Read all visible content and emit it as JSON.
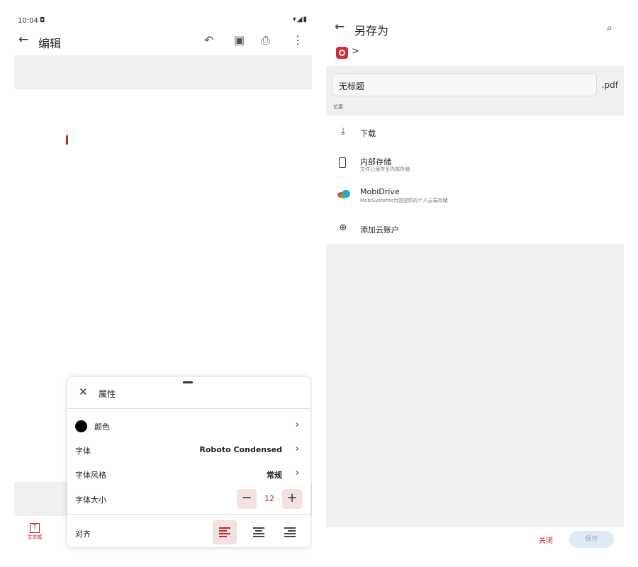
{
  "left": {
    "status": {
      "time": "10:04",
      "notif": "◘",
      "sys": "▾◢▮"
    },
    "appbar": {
      "back": "←",
      "title": "编辑",
      "undo": "↶",
      "save": "▣",
      "print": "⎙",
      "more": "⋮"
    },
    "bottom_tool": {
      "icon": "T",
      "label": "文本框"
    },
    "properties": {
      "close": "✕",
      "title": "属性",
      "color_label": "颜色",
      "color_value": "#000000",
      "font_label": "字体",
      "font_value": "Roboto Condensed",
      "style_label": "字体风格",
      "style_value": "常规",
      "size_label": "字体大小",
      "size_value": "12",
      "minus": "−",
      "plus": "+",
      "align_label": "对齐",
      "chevron": "›"
    }
  },
  "right": {
    "appbar": {
      "back": "←",
      "title": "另存为",
      "search": "⌕"
    },
    "breadcrumb_arrow": ">",
    "filename": "无标题",
    "extension": ".pdf",
    "location_label": "位置",
    "locations": [
      {
        "icon": "download-icon",
        "glyph": "⤓",
        "title": "下载",
        "subtitle": ""
      },
      {
        "icon": "phone-icon",
        "glyph": "",
        "title": "内部存储",
        "subtitle": "文件已保存至内部存储"
      },
      {
        "icon": "mobidrive-icon",
        "glyph": "",
        "title": "MobiDrive",
        "subtitle": "MobiSystems为您提供的个人云端存储"
      },
      {
        "icon": "cloud-add-icon",
        "glyph": "⊕",
        "title": "添加云账户",
        "subtitle": ""
      }
    ],
    "close_label": "关闭",
    "save_label": "保存"
  },
  "colors": {
    "accent": "#c0262c",
    "panel_gray": "#f0f0f0",
    "disabled_blue": "#dfeaf6"
  }
}
